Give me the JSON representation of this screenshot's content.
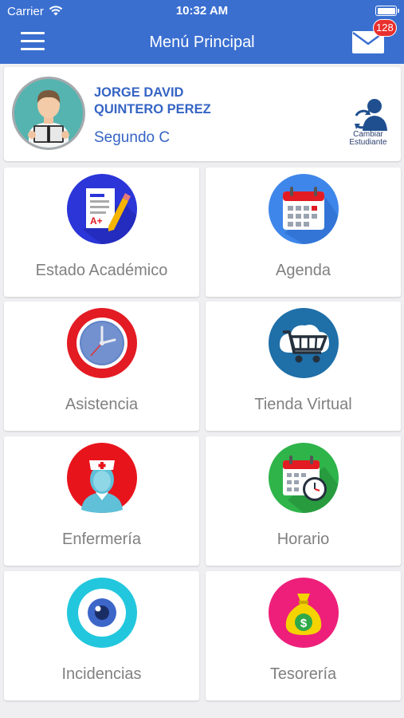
{
  "status_bar": {
    "carrier": "Carrier",
    "time": "10:32 AM"
  },
  "header": {
    "title": "Menú Principal",
    "unread_count": "128"
  },
  "student": {
    "first_names": "JORGE DAVID",
    "last_names": "QUINTERO PEREZ",
    "grade": "Segundo C",
    "change_line1": "Cambiar",
    "change_line2": "Estudiante"
  },
  "menu": [
    {
      "label": "Estado Académico",
      "icon": "report-card-icon",
      "color": "#2b35d8"
    },
    {
      "label": "Agenda",
      "icon": "calendar-icon",
      "color": "#3f86ea"
    },
    {
      "label": "Asistencia",
      "icon": "clock-icon",
      "color": "#e31b23"
    },
    {
      "label": "Tienda Virtual",
      "icon": "shopping-cart-icon",
      "color": "#1f6fa8"
    },
    {
      "label": "Enfermería",
      "icon": "nurse-icon",
      "color": "#e8141c"
    },
    {
      "label": "Horario",
      "icon": "schedule-icon",
      "color": "#2fb44a"
    },
    {
      "label": "Incidencias",
      "icon": "eye-icon",
      "color": "#22c7dd"
    },
    {
      "label": "Tesorería",
      "icon": "money-bag-icon",
      "color": "#ee1f7a"
    }
  ]
}
